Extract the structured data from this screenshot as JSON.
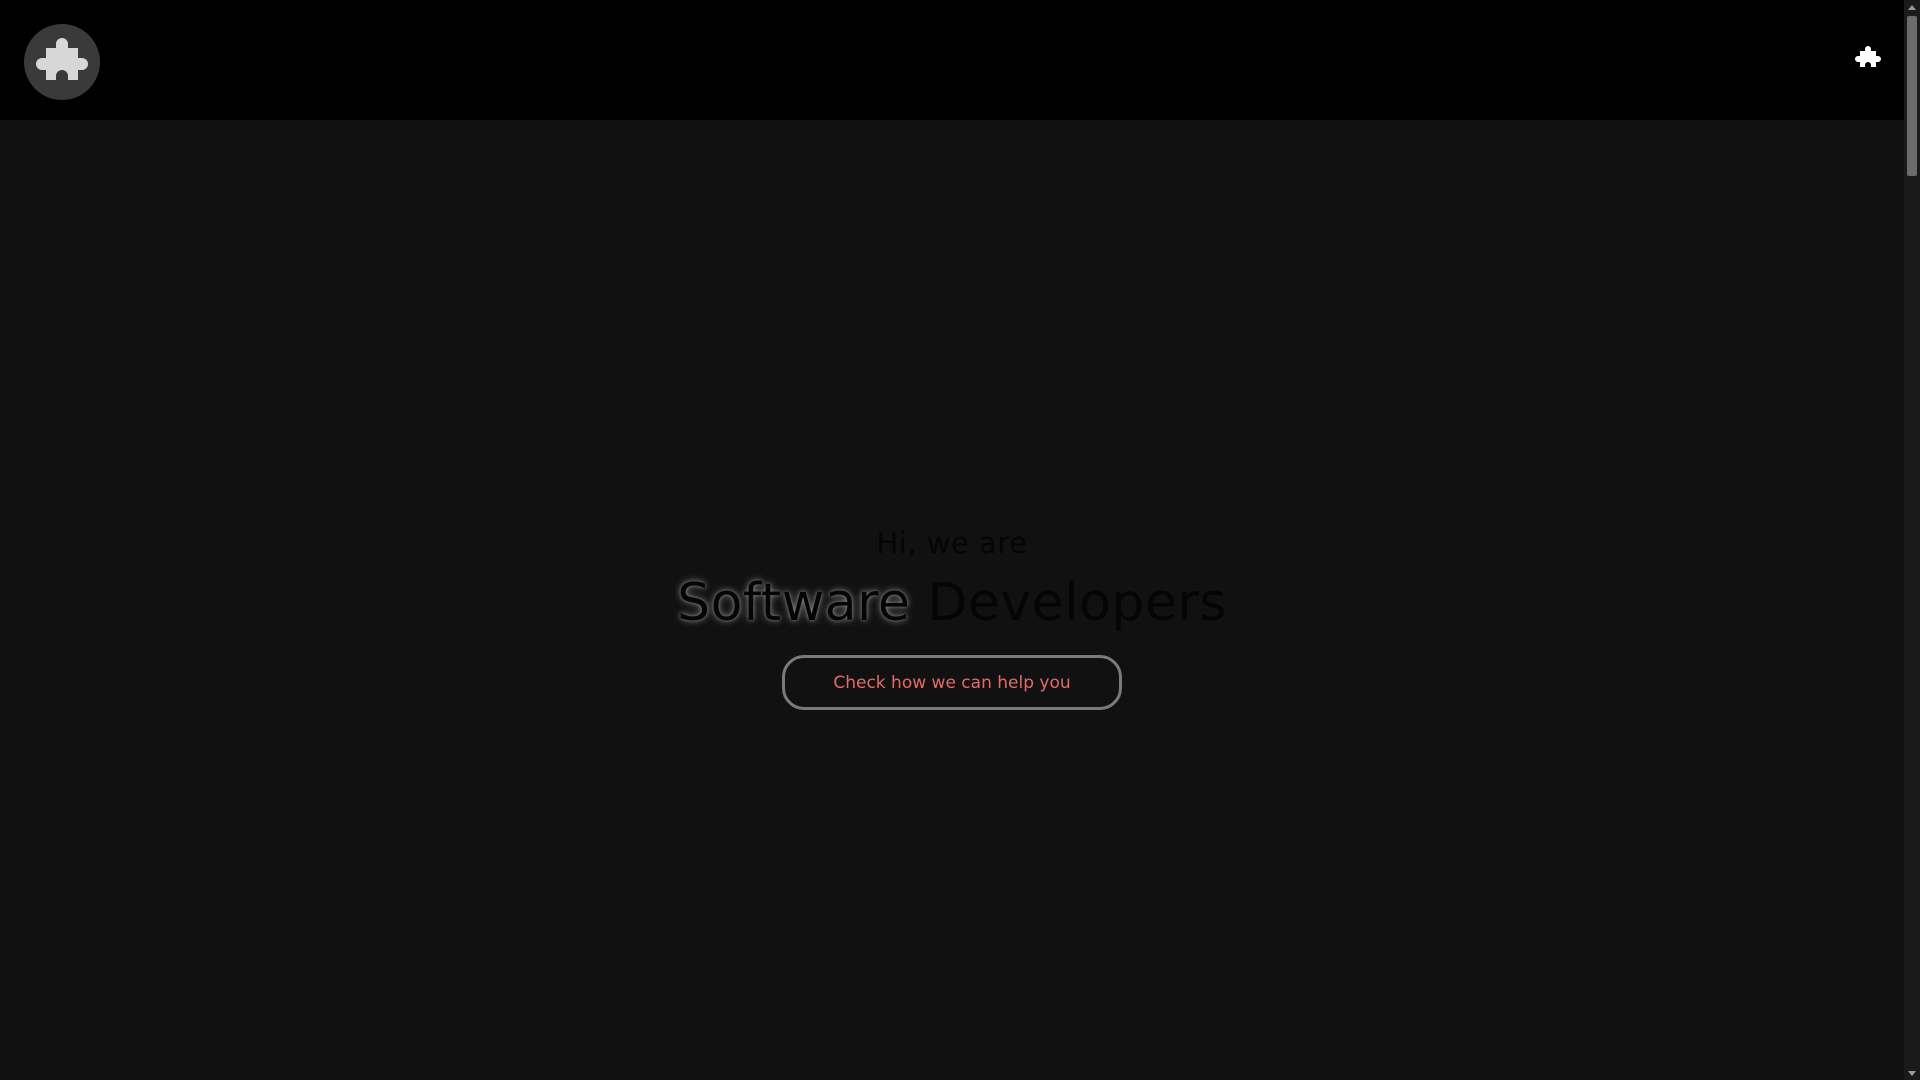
{
  "header": {
    "logo_icon": "puzzle-piece-icon",
    "menu_icon": "puzzle-piece-icon"
  },
  "hero": {
    "greeting": "Hi, we are",
    "title_part1": "Software",
    "title_part2": "Developers",
    "cta_label": "Check how we can help you"
  },
  "colors": {
    "background": "#111111",
    "header_background": "#000000",
    "logo_circle": "#3a3a3a",
    "cta_text": "#e46a6a",
    "cta_border": "#7a7a7a"
  }
}
